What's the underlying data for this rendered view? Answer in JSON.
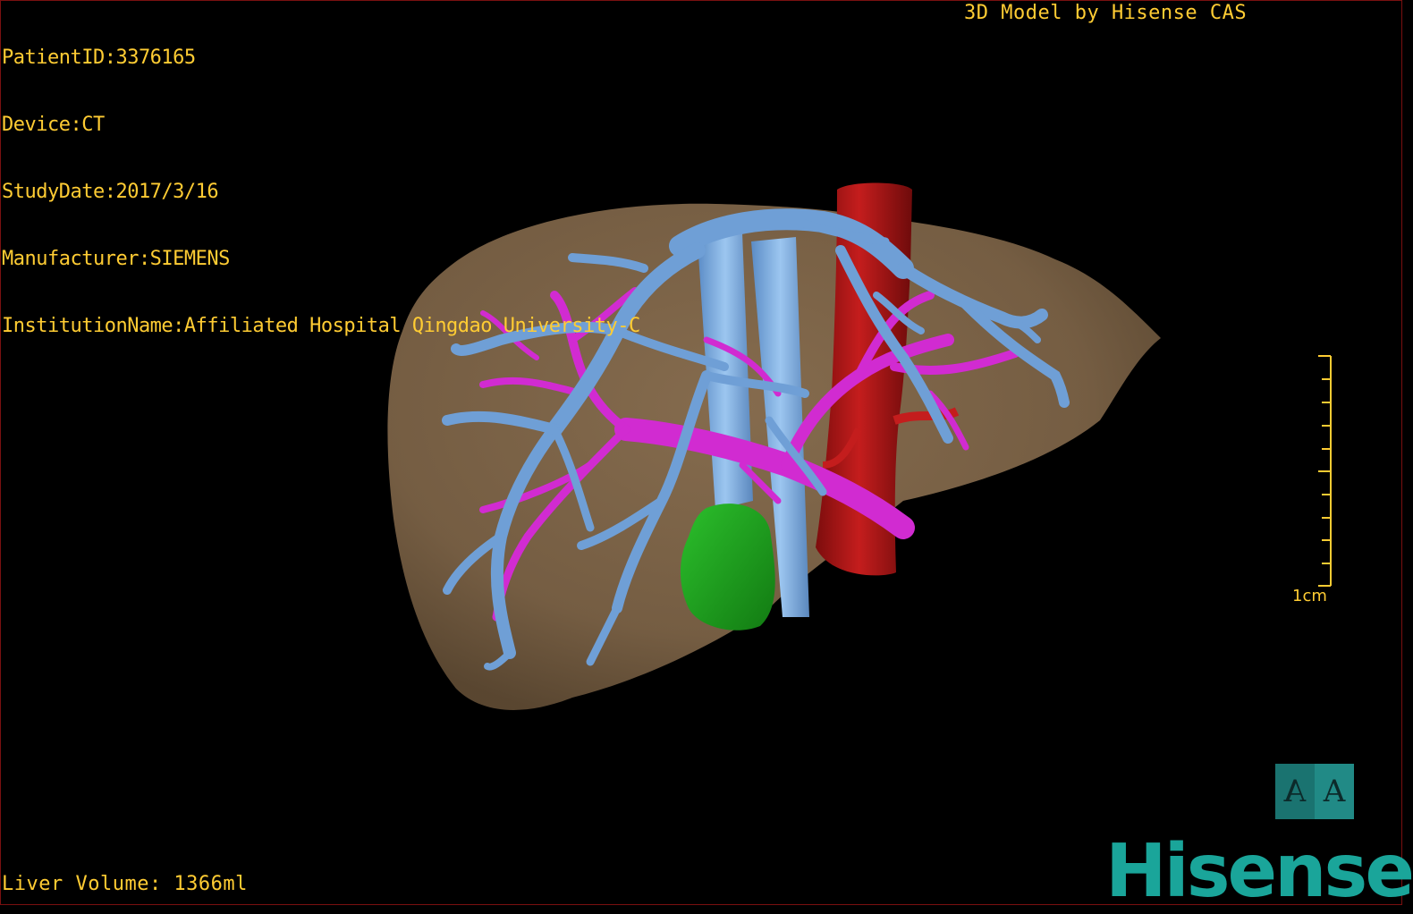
{
  "info": {
    "patient_id": "PatientID:3376165",
    "device": "Device:CT",
    "study_date": "StudyDate:2017/3/16",
    "manufacturer": "Manufacturer:SIEMENS",
    "institution": "InstitutionName:Affiliated Hospital Qingdao University-C"
  },
  "credit": "3D Model by Hisense CAS",
  "liver_volume": "Liver Volume: 1366ml",
  "scale_bar": {
    "label": "1cm"
  },
  "orientation_cube": {
    "left_glyph": "A",
    "right_glyph": "A"
  },
  "logo": {
    "text": "Hisense"
  },
  "colors": {
    "text": "#ffcc33",
    "liver": "#8a7052",
    "portal_vein": "#6f9fd6",
    "hepatic_artery": "#d12bd1",
    "ivc": "#b01414",
    "gallbladder": "#1fae1f",
    "logo": "#1aa59a"
  }
}
